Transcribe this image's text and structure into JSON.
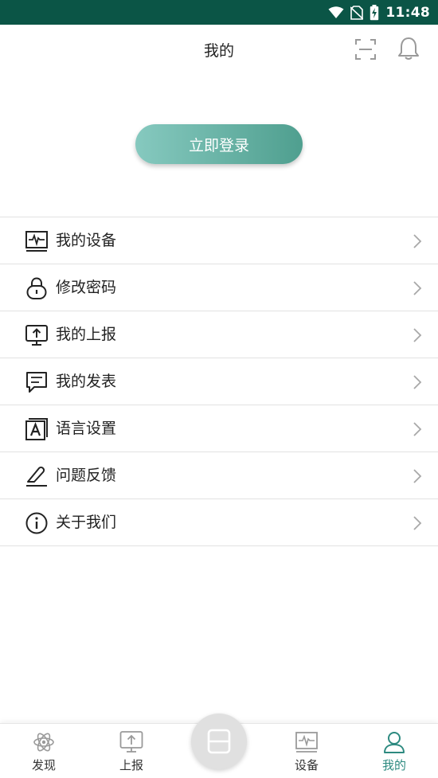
{
  "status_bar": {
    "time": "11:48"
  },
  "header": {
    "title": "我的"
  },
  "login": {
    "label": "立即登录"
  },
  "menu": {
    "items": [
      {
        "label": "我的设备",
        "icon": "device-monitor-icon"
      },
      {
        "label": "修改密码",
        "icon": "lock-icon"
      },
      {
        "label": "我的上报",
        "icon": "upload-monitor-icon"
      },
      {
        "label": "我的发表",
        "icon": "message-icon"
      },
      {
        "label": "语言设置",
        "icon": "language-icon"
      },
      {
        "label": "问题反馈",
        "icon": "edit-feedback-icon"
      },
      {
        "label": "关于我们",
        "icon": "info-icon"
      }
    ]
  },
  "tabs": {
    "items": [
      {
        "label": "发现",
        "icon": "atom-icon"
      },
      {
        "label": "上报",
        "icon": "upload-icon"
      },
      {
        "label": "设备",
        "icon": "device-icon"
      },
      {
        "label": "我的",
        "icon": "user-icon",
        "active": true
      }
    ]
  },
  "colors": {
    "status_bar": "#0b5546",
    "accent": "#2d8a80",
    "login_gradient_start": "#86c9bf",
    "login_gradient_end": "#4f9f8f"
  }
}
